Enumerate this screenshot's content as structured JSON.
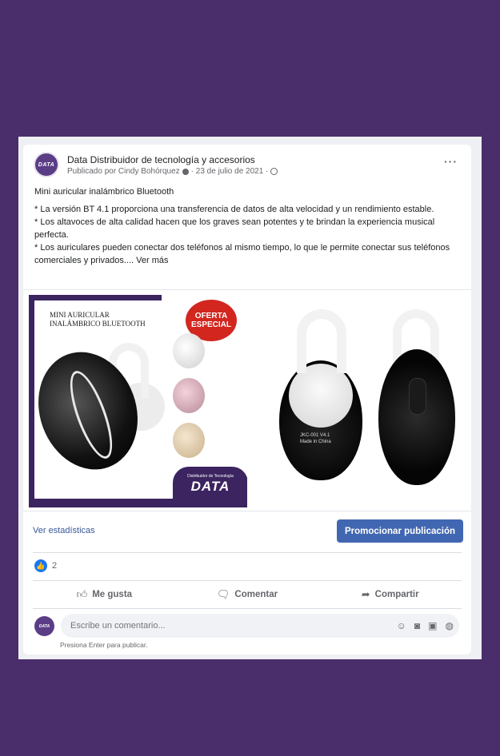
{
  "post": {
    "page_name": "Data Distribuidor de tecnología y accesorios",
    "published_by": "Publicado por Cindy Bohórquez",
    "date": "· 23 de julio de 2021 ·",
    "more": "···",
    "avatar_text": "DATA",
    "paragraphs": [
      "Mini auricular inalámbrico Bluetooth",
      "* La versión BT 4.1 proporciona una transferencia de datos de alta velocidad y un rendimiento estable.",
      "* Los altavoces de alta calidad hacen que los graves sean potentes y te brindan la experiencia musical perfecta.",
      "* Los auriculares pueden conectar dos teléfonos al mismo tiempo, lo que le permite conectar sus teléfonos comerciales y privados...."
    ],
    "see_more": "Ver más"
  },
  "image": {
    "promo_title_1": "MINI AURICULAR",
    "promo_title_2": "INALÁMBRICO BLUETOOTH",
    "badge_1": "OFERTA",
    "badge_2": "ESPECIAL",
    "logo_small": "Distribuidor de Tecnología",
    "logo_big": "DATA",
    "device_label_1": "JKC-001 V4.1",
    "device_label_2": "Made in China"
  },
  "actions": {
    "stats": "Ver estadísticas",
    "promote": "Promocionar publicación",
    "like_count": "2",
    "like": "Me gusta",
    "comment": "Comentar",
    "share": "Compartir"
  },
  "comment": {
    "placeholder": "Escribe un comentario...",
    "hint": "Presiona Enter para publicar."
  },
  "colors": {
    "background": "#4a2d6b",
    "brand_purple": "#3b2460",
    "promote_button": "#4267b2",
    "like_blue": "#1877f2"
  }
}
